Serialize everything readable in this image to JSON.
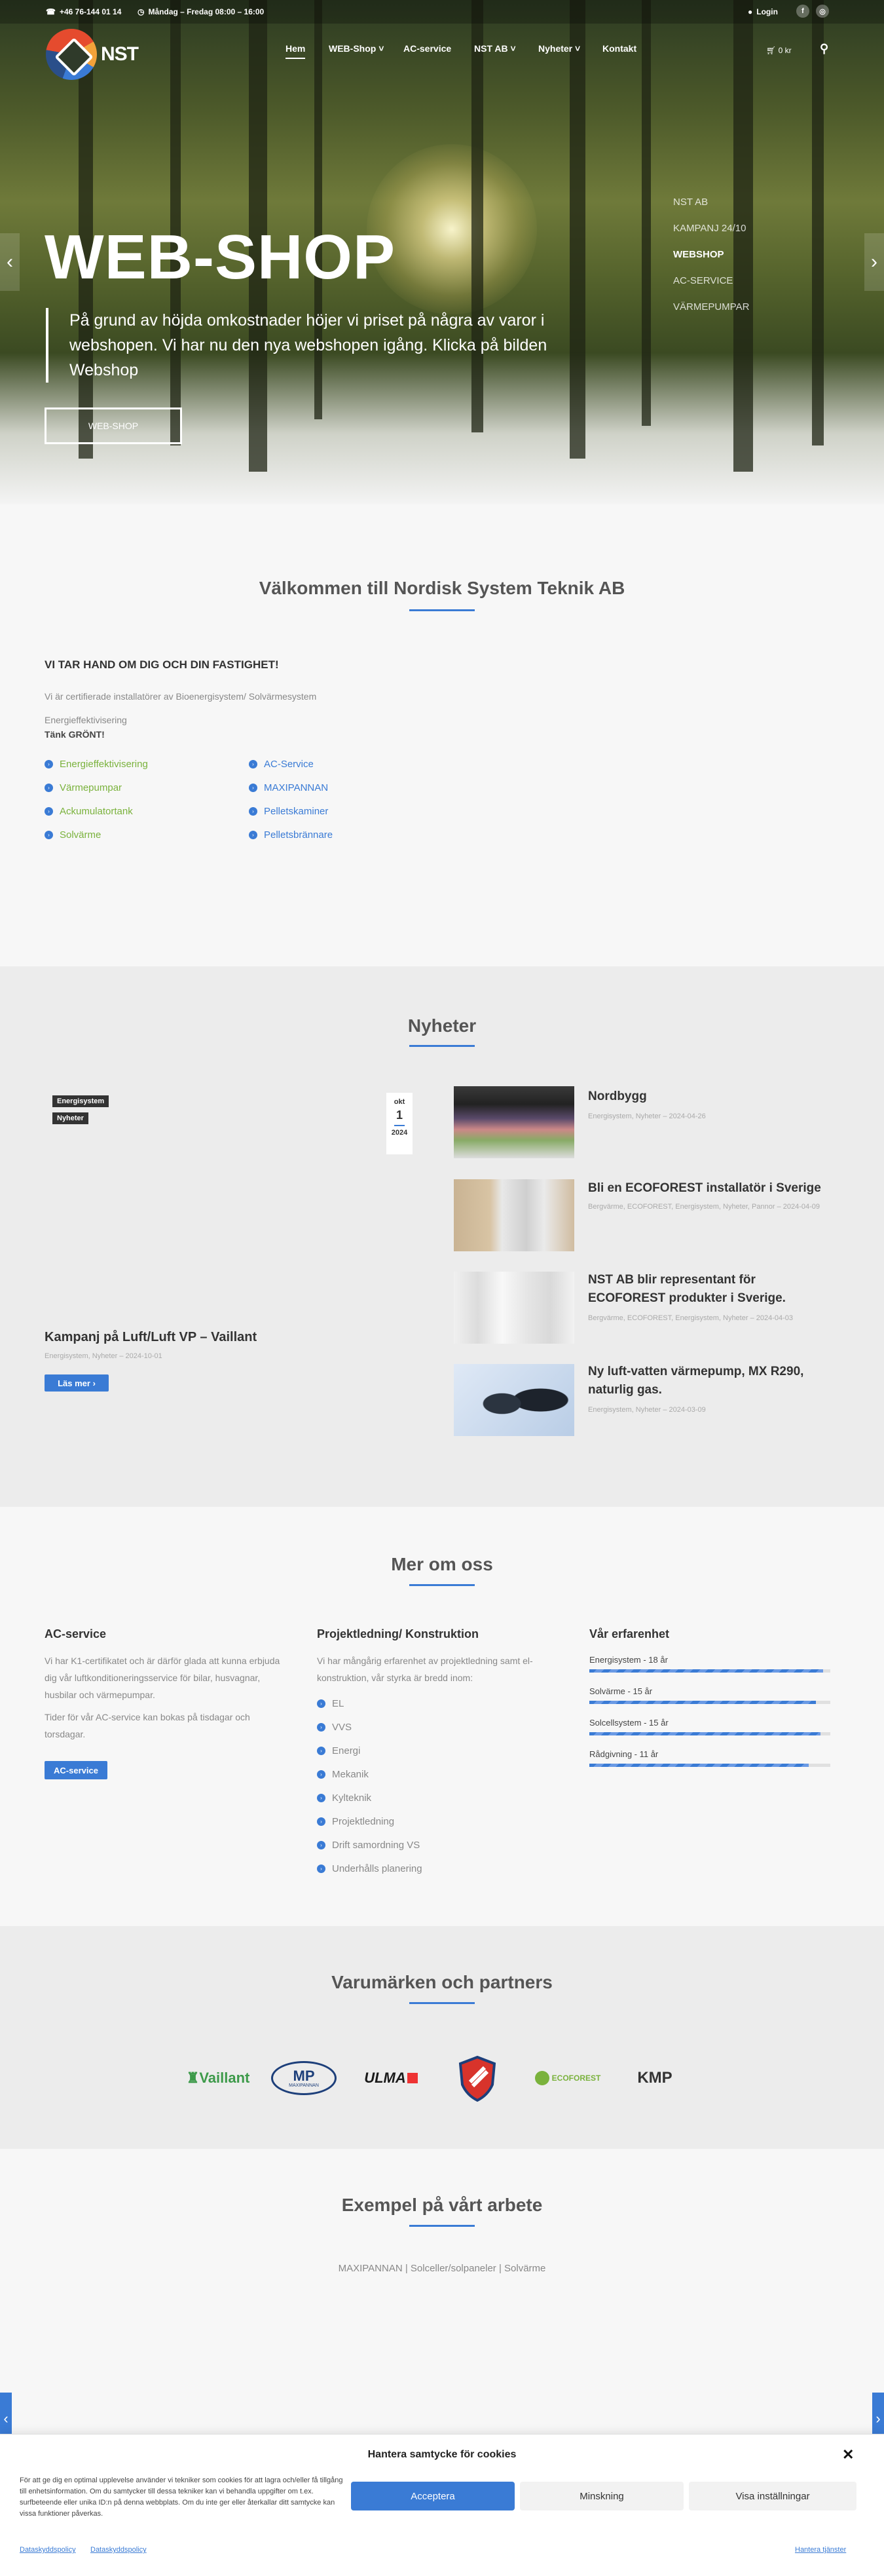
{
  "topbar": {
    "phone": "+46 76-144 01 14",
    "hours": "Måndag – Fredag 08:00 – 16:00",
    "login": "Login"
  },
  "header": {
    "logo_text": "NST",
    "nav": [
      "Hem",
      "WEB-Shop",
      "AC-service",
      "NST AB",
      "Nyheter",
      "Kontakt"
    ],
    "cart": "0 kr"
  },
  "hero": {
    "title": "WEB-SHOP",
    "text": "På grund av höjda omkostnader höjer vi priset på några av varor i webshopen. Vi har nu den nya webshopen igång. Klicka på bilden Webshop",
    "button": "WEB-SHOP",
    "slides": [
      "NST AB",
      "KAMPANJ 24/10",
      "WEBSHOP",
      "AC-SERVICE",
      "VÄRMEPUMPAR"
    ]
  },
  "welcome": {
    "title": "Välkommen till Nordisk System Teknik AB",
    "heading": "VI TAR HAND OM DIG OCH DIN FASTIGHET!",
    "line1": "Vi är certifierade installatörer av Bioenergisystem/ Solvärmesystem",
    "line2": "Energieffektivisering",
    "line3": "Tänk GRÖNT!",
    "list_left": [
      "Energieffektivisering",
      "Värmepumpar",
      "Ackumulatortank",
      "Solvärme"
    ],
    "list_right": [
      "AC-Service",
      "MAXIPANNAN",
      "Pelletskaminer",
      "Pelletsbrännare"
    ]
  },
  "news": {
    "title": "Nyheter",
    "featured": {
      "tags": [
        "Energisystem",
        "Nyheter"
      ],
      "date_month": "okt",
      "date_day": "1",
      "date_year": "2024",
      "title": "Kampanj på Luft/Luft VP – Vaillant",
      "meta": "Energisystem, Nyheter  –  2024-10-01",
      "button": "Läs mer"
    },
    "items": [
      {
        "title": "Nordbygg",
        "meta": "Energisystem, Nyheter  –  2024-04-26"
      },
      {
        "title": "Bli en ECOFOREST installatör i Sverige",
        "meta": "Bergvärme, ECOFOREST, Energisystem, Nyheter, Pannor  –  2024-04-09"
      },
      {
        "title": "NST AB blir representant för ECOFOREST produkter i Sverige.",
        "meta": "Bergvärme, ECOFOREST, Energisystem, Nyheter  –  2024-04-03"
      },
      {
        "title": "Ny luft-vatten värmepump, MX R290, naturlig gas.",
        "meta": "Energisystem, Nyheter  –  2024-03-09"
      }
    ]
  },
  "about": {
    "title": "Mer om oss",
    "ac": {
      "heading": "AC-service",
      "p1": "Vi har K1-certifikatet och är därför glada att kunna erbjuda dig vår luftkonditioneringsservice för bilar, husvagnar, husbilar och värmepumpar.",
      "p2": "Tider för vår AC-service kan bokas på tisdagar och torsdagar.",
      "button": "AC-service"
    },
    "projekt": {
      "heading": "Projektledning/ Konstruktion",
      "p1": "Vi har mångårig erfarenhet av projektledning samt el-konstruktion, vår styrka är bredd inom:",
      "list": [
        "EL",
        "VVS",
        "Energi",
        "Mekanik",
        "Kylteknik",
        "Projektledning",
        "Drift samordning VS",
        "Underhålls planering"
      ]
    },
    "exp": {
      "heading": "Vår erfarenhet",
      "bars": [
        {
          "label": "Energisystem - 18 år",
          "value": 0.97
        },
        {
          "label": "Solvärme - 15 år",
          "value": 0.94
        },
        {
          "label": "Solcellsystem - 15 år",
          "value": 0.96
        },
        {
          "label": "Rådgivning - 11 år",
          "value": 0.91
        }
      ]
    }
  },
  "brands": {
    "title": "Varumärken och partners",
    "items": [
      "Vaillant",
      "MP",
      "ULMA",
      "Shield",
      "ECOFOREST",
      "KMP"
    ],
    "mp_sub": "MAXIPANNAN"
  },
  "examples": {
    "title": "Exempel på vårt arbete",
    "filters": "MAXIPANNAN | Solceller/solpaneler | Solvärme"
  },
  "cookie": {
    "title": "Hantera samtycke för cookies",
    "text": "För att ge dig en optimal upplevelse använder vi tekniker som cookies för att lagra och/eller få tillgång till enhetsinformation. Om du samtycker till dessa tekniker kan vi behandla uppgifter om t.ex. surfbeteende eller unika ID:n på denna webbplats. Om du inte ger eller återkallar ditt samtycke kan vissa funktioner påverkas.",
    "accept": "Acceptera",
    "deny": "Minskning",
    "settings": "Visa inställningar",
    "link1": "Dataskyddspolicy",
    "link2": "Dataskyddspolicy",
    "manage": "Hantera tjänster"
  },
  "colors": {
    "accent": "#3a7bd5",
    "green": "#7ab23c"
  }
}
